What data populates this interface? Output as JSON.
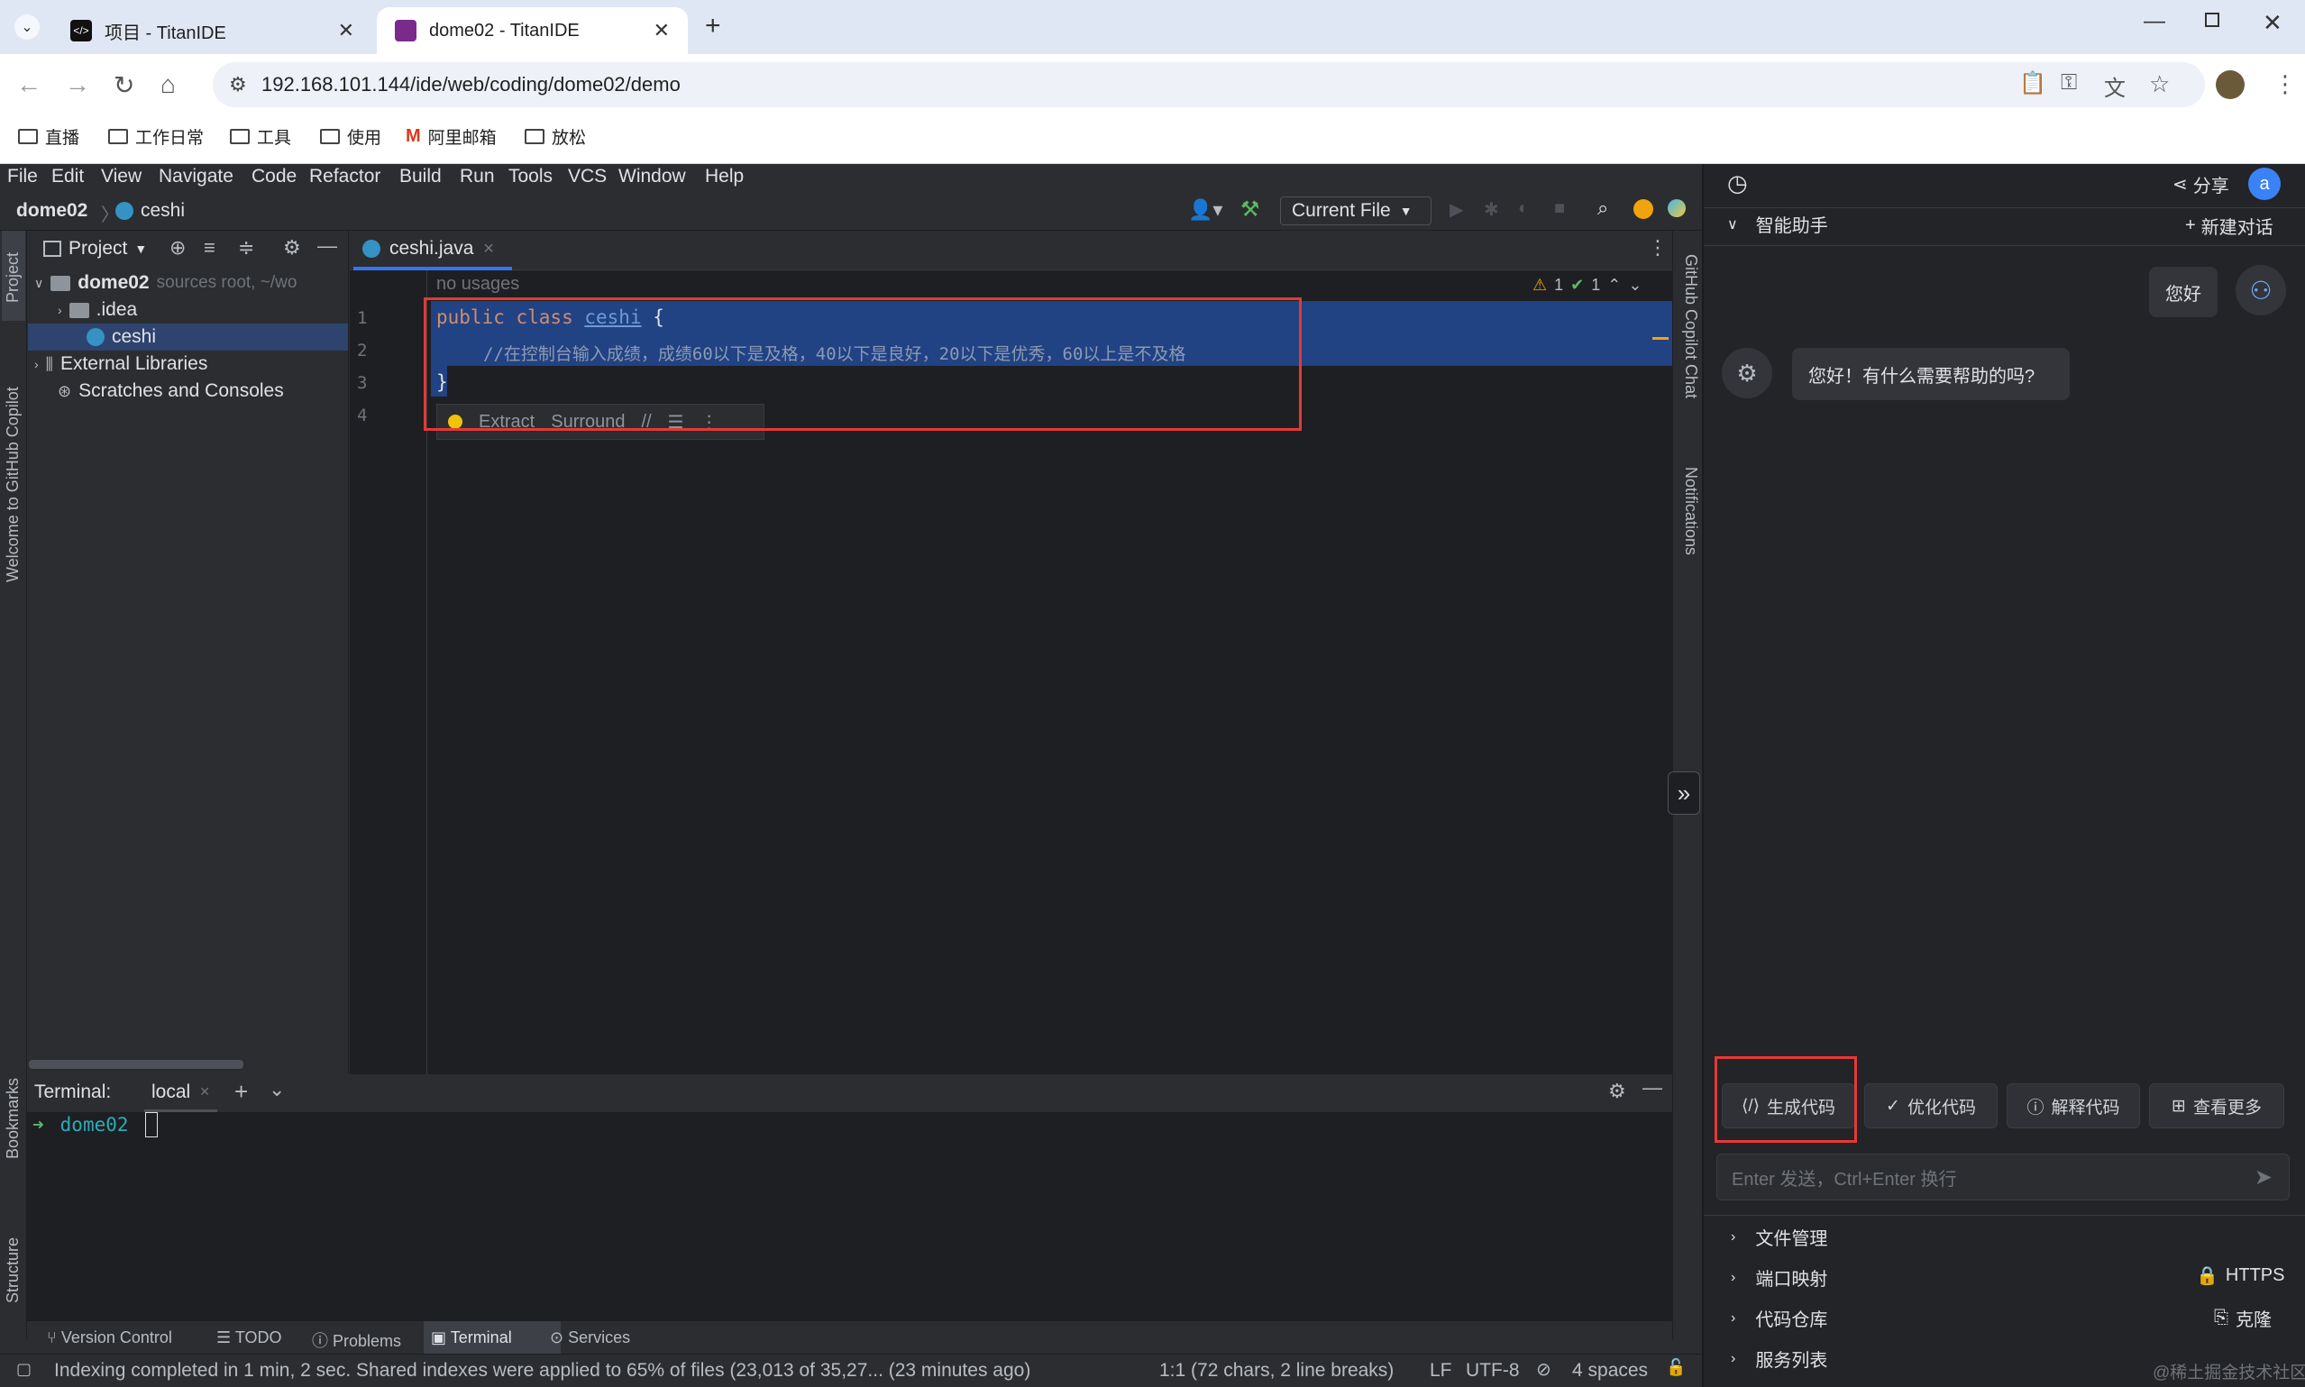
{
  "browser": {
    "tabs": [
      {
        "title": "项目 - TitanIDE",
        "active": false
      },
      {
        "title": "dome02 - TitanIDE",
        "active": true
      }
    ],
    "url": "192.168.101.144/ide/web/coding/dome02/demo",
    "bookmarks": [
      "直播",
      "工作日常",
      "工具",
      "使用",
      "阿里邮箱",
      "放松"
    ]
  },
  "ide": {
    "menu": [
      "File",
      "Edit",
      "View",
      "Navigate",
      "Code",
      "Refactor",
      "Build",
      "Run",
      "Tools",
      "VCS",
      "Window",
      "Help"
    ],
    "breadcrumb": {
      "project": "dome02",
      "file": "ceshi"
    },
    "run_config": "Current File",
    "project_panel": {
      "title": "Project",
      "root": "dome02",
      "root_hint": "sources root, ~/wo",
      "items": [
        ".idea",
        "ceshi",
        "External Libraries",
        "Scratches and Consoles"
      ]
    },
    "editor": {
      "tab": "ceshi.java",
      "usages_hint": "no usages",
      "inspections": {
        "warnings": "1",
        "ok": "1"
      },
      "lines": [
        "1",
        "2",
        "3",
        "4"
      ],
      "code": {
        "kw1": "public class",
        "classname": "ceshi",
        "brace_open": " {",
        "comment": "//在控制台输入成绩，成绩60以下是及格，40以下是良好，20以下是优秀，60以上是不及格",
        "brace_close": "}"
      },
      "popup": {
        "extract": "Extract",
        "surround": "Surround"
      }
    },
    "left_strip": {
      "project": "Project",
      "copilot": "Welcome to GitHub Copilot",
      "bookmarks": "Bookmarks",
      "structure": "Structure"
    },
    "right_strip": {
      "copilot_chat": "GitHub Copilot Chat",
      "notifications": "Notifications"
    },
    "terminal": {
      "label": "Terminal:",
      "tab": "local",
      "prompt_arrow": "➜",
      "prompt_dir": "dome02"
    },
    "tool_tabs": [
      "Version Control",
      "TODO",
      "Problems",
      "Terminal",
      "Services"
    ],
    "status": {
      "message": "Indexing completed in 1 min, 2 sec. Shared indexes were applied to 65% of files (23,013 of 35,27... (23 minutes ago)",
      "position": "1:1 (72 chars, 2 line breaks)",
      "line_sep": "LF",
      "encoding": "UTF-8",
      "indent": "4 spaces"
    }
  },
  "assistant": {
    "share": "分享",
    "avatar_letter": "a",
    "title": "智能助手",
    "new_chat": "新建对话",
    "user_msg": "您好",
    "bot_msg": "您好！有什么需要帮助的吗?",
    "actions": [
      "生成代码",
      "优化代码",
      "解释代码",
      "查看更多"
    ],
    "input_placeholder": "Enter 发送，Ctrl+Enter 换行",
    "sections": [
      {
        "label": "文件管理",
        "extra": ""
      },
      {
        "label": "端口映射",
        "extra": "HTTPS"
      },
      {
        "label": "代码仓库",
        "extra": "克隆"
      },
      {
        "label": "服务列表",
        "extra": ""
      }
    ],
    "watermark": "@稀土掘金技术社区"
  },
  "colors": {
    "accent": "#3574f0",
    "selection": "#214283",
    "highlight_box": "#e53935",
    "keyword": "#cf8e6d",
    "comment": "#7a7e85",
    "terminal_dir": "#2aacb8"
  }
}
